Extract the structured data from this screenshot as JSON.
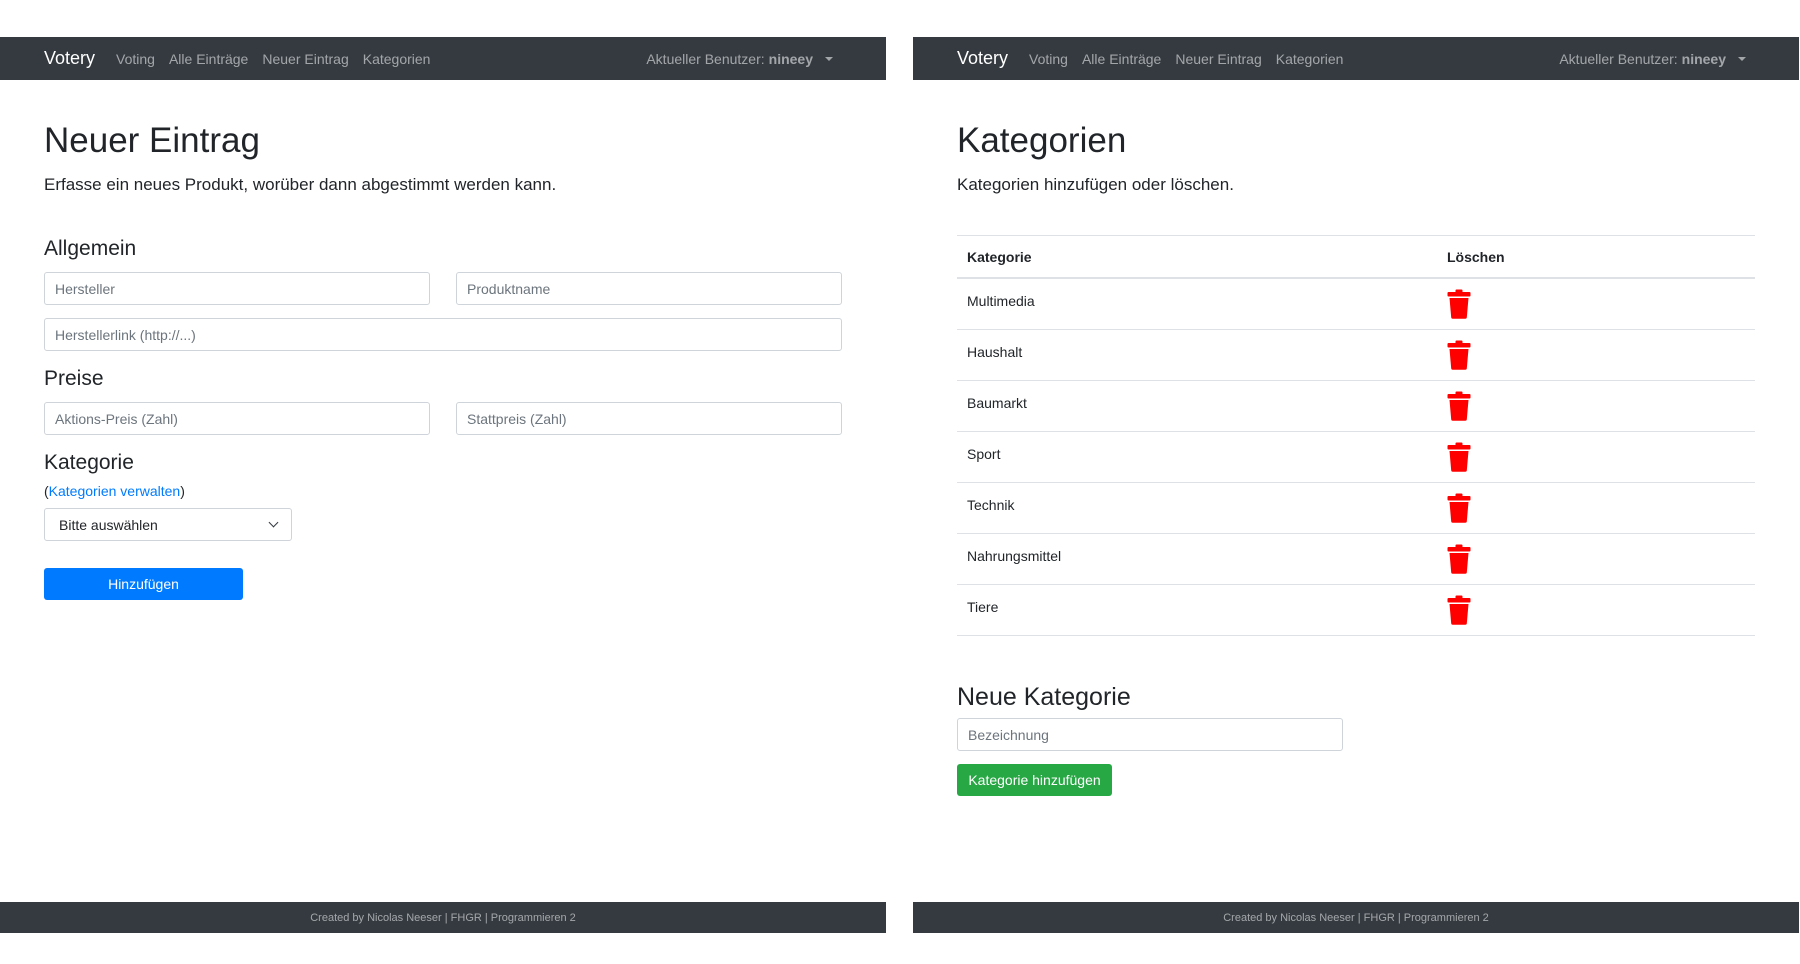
{
  "left": {
    "navbar": {
      "brand": "Votery",
      "links": [
        "Voting",
        "Alle Einträge",
        "Neuer Eintrag",
        "Kategorien"
      ],
      "user_label": "Aktueller Benutzer:",
      "user_name": "nineey"
    },
    "title": "Neuer Eintrag",
    "lead": "Erfasse ein neues Produkt, worüber dann abgestimmt werden kann.",
    "section_general": "Allgemein",
    "placeholders": {
      "manufacturer": "Hersteller",
      "product_name": "Produktname",
      "manufacturer_link": "Herstellerlink (http://...)",
      "sale_price": "Aktions-Preis (Zahl)",
      "regular_price": "Stattpreis (Zahl)"
    },
    "section_prices": "Preise",
    "section_category": "Kategorie",
    "manage_link_open": "(",
    "manage_link": "Kategorien verwalten",
    "manage_link_close": ")",
    "select_value": "Bitte auswählen",
    "submit_label": "Hinzufügen",
    "footer": "Created by Nicolas Neeser | FHGR | Programmieren 2"
  },
  "right": {
    "navbar": {
      "brand": "Votery",
      "links": [
        "Voting",
        "Alle Einträge",
        "Neuer Eintrag",
        "Kategorien"
      ],
      "user_label": "Aktueller Benutzer:",
      "user_name": "nineey"
    },
    "title": "Kategorien",
    "lead": "Kategorien hinzufügen oder löschen.",
    "table": {
      "headers": [
        "Kategorie",
        "Löschen"
      ],
      "rows": [
        "Multimedia",
        "Haushalt",
        "Baumarkt",
        "Sport",
        "Technik",
        "Nahrungsmittel",
        "Tiere"
      ]
    },
    "new_section": "Neue Kategorie",
    "new_placeholder": "Bezeichnung",
    "add_label": "Kategorie hinzufügen",
    "footer": "Created by Nicolas Neeser | FHGR | Programmieren 2"
  },
  "colors": {
    "navbar": "#343a40",
    "primary": "#007bff",
    "success": "#28a745",
    "danger_icon": "#ff0000"
  },
  "icons": {
    "delete": "trash-icon",
    "user_menu": "caret-down-icon",
    "select": "chevron-down-icon"
  }
}
